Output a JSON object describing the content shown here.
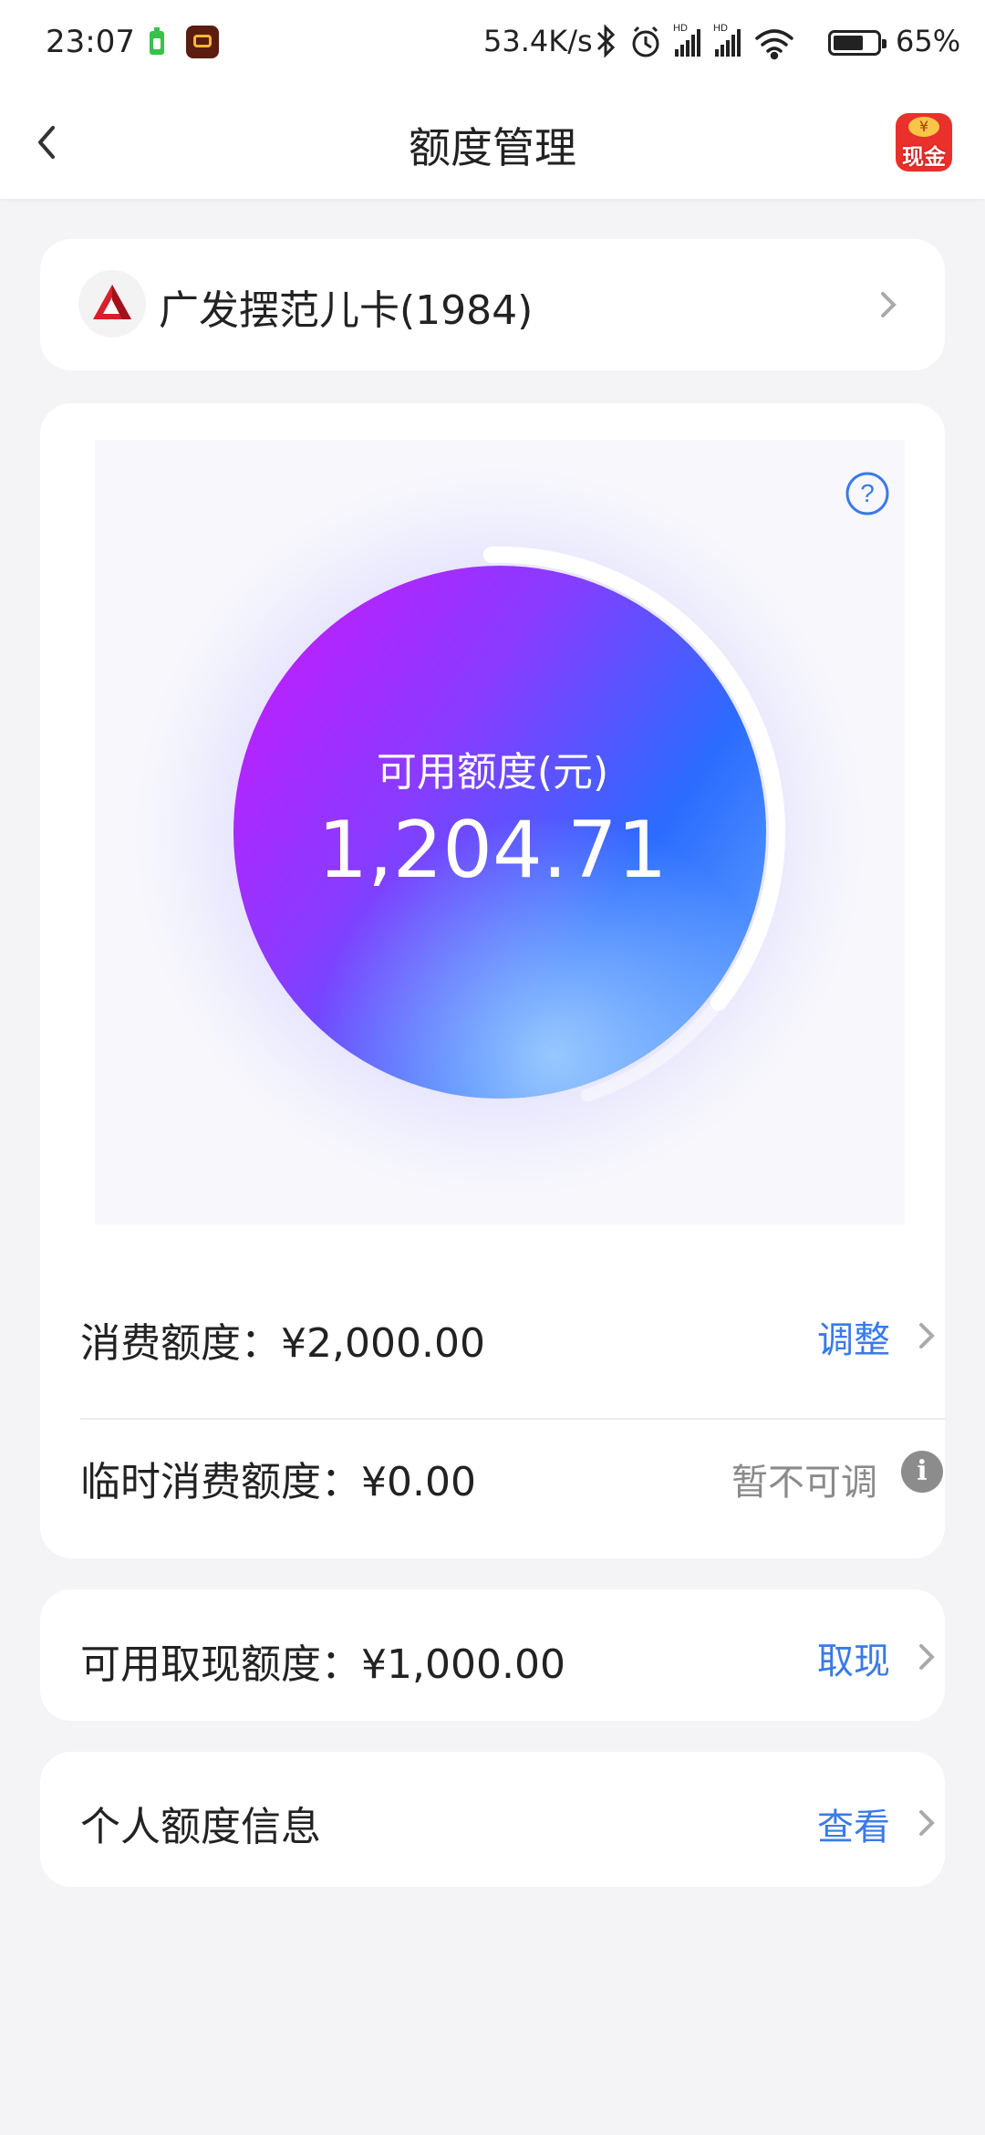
{
  "status_bar": {
    "time": "23:07",
    "net_speed": "53.4K/s",
    "battery": "65%",
    "icons": [
      "battery-app-icon",
      "crown-app-icon",
      "bluetooth-icon",
      "alarm-icon",
      "hd-signal-icon",
      "hd-signal-icon",
      "wifi-icon",
      "battery-icon"
    ]
  },
  "nav": {
    "title": "额度管理",
    "redpack_label": "现金",
    "redpack_coin": "¥"
  },
  "bank_card": {
    "name": "广发摆范儿卡(1984)"
  },
  "quota": {
    "available_label": "可用额度(元)",
    "available_value": "1,204.71",
    "available_fraction": 0.6,
    "consume_label": "消费额度：",
    "consume_value": "¥2,000.00",
    "consume_action": "调整",
    "temp_label": "临时消费额度：",
    "temp_value": "¥0.00",
    "temp_status": "暂不可调"
  },
  "cash": {
    "label": "可用取现额度：",
    "value": "¥1,000.00",
    "action": "取现"
  },
  "personal": {
    "label": "个人额度信息",
    "action": "查看"
  },
  "colors": {
    "accent": "#3a7ae8",
    "bank_red": "#d6202a",
    "ring_purple": "#b224f5",
    "ring_blue": "#2b6cff"
  }
}
